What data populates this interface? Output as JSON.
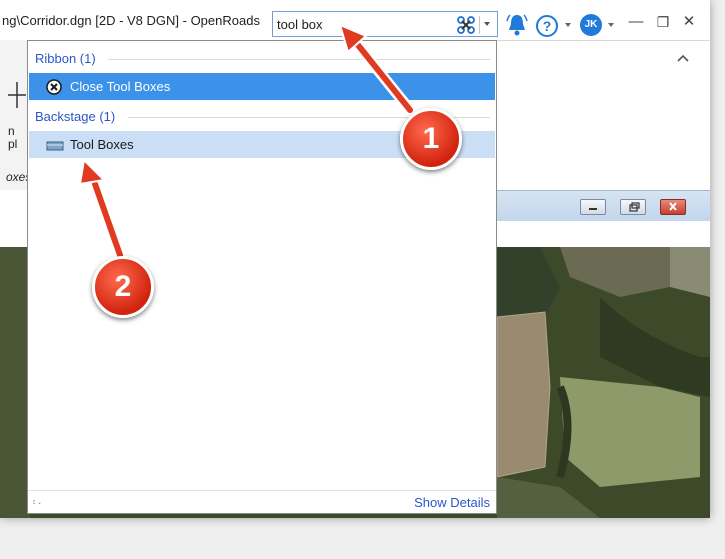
{
  "window": {
    "title": "ng\\Corridor.dgn [2D - V8 DGN] - OpenRoads"
  },
  "search": {
    "value": "tool box",
    "placeholder": ""
  },
  "toolbar": {
    "icons": [
      "clear-search-icon",
      "search-dropdown-icon",
      "notification-bell-icon",
      "help-icon",
      "user-avatar-icon",
      "minimize-icon",
      "restore-icon",
      "close-icon"
    ],
    "avatar_initials": "JK",
    "minimize_glyph": "—",
    "restore_glyph": "❐",
    "close_glyph": "✕"
  },
  "results": {
    "groups": [
      {
        "header": "Ribbon (1)",
        "items": [
          {
            "label": "Close Tool Boxes",
            "icon": "close-circle-icon",
            "state": "selected"
          }
        ]
      },
      {
        "header": "Backstage (1)",
        "items": [
          {
            "label": "Tool Boxes",
            "icon": "toolbox-icon",
            "state": "hover"
          }
        ]
      }
    ],
    "footer": {
      "show_details": "Show Details"
    }
  },
  "left_strip": {
    "label_n": "n",
    "label_pl": "pl",
    "tab_label": "oxes"
  },
  "callouts": [
    {
      "number": "1"
    },
    {
      "number": "2"
    }
  ],
  "colors": {
    "accent": "#3b92e8",
    "hover": "#cadff5",
    "group_header": "#2a57c9",
    "badge": "#d1230f",
    "bell": "#1f7ad9"
  }
}
